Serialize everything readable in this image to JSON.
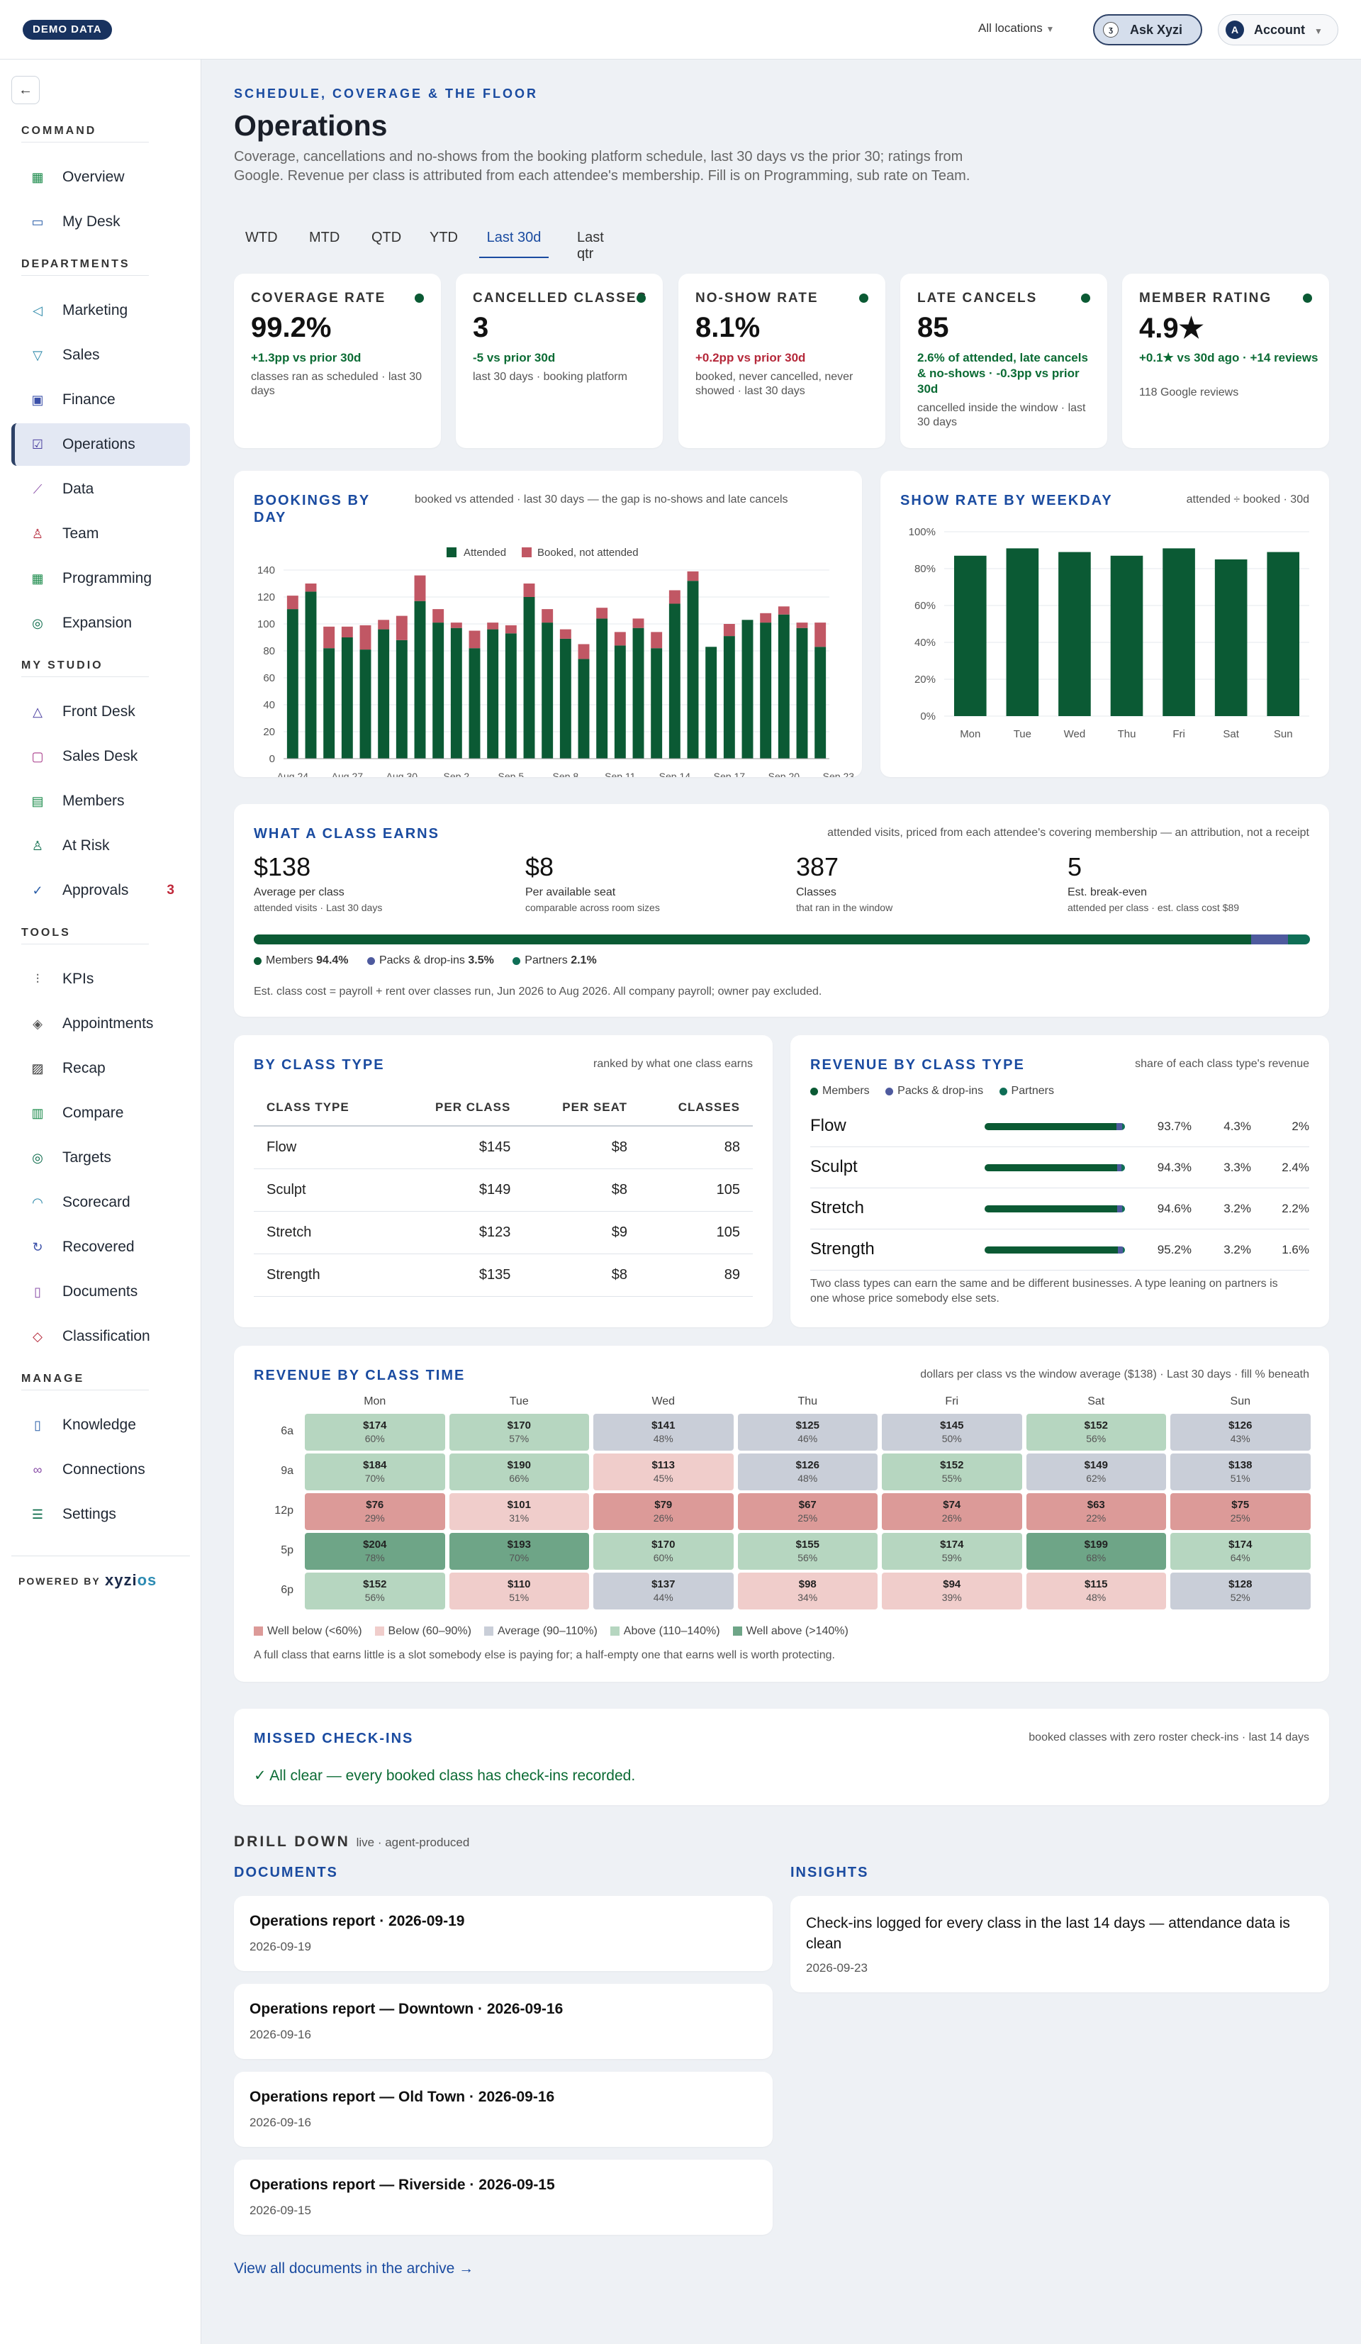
{
  "topbar": {
    "demo_badge": "DEMO DATA",
    "locations": "All locations",
    "ask_label": "Ask Xyzi",
    "ask_icon": "ʒ",
    "account_label": "Account",
    "account_initial": "A"
  },
  "sidebar": {
    "sections": {
      "command": "COMMAND",
      "departments": "DEPARTMENTS",
      "my_studio": "MY STUDIO",
      "tools": "TOOLS",
      "manage": "MANAGE"
    },
    "items": {
      "overview": "Overview",
      "my_desk": "My Desk",
      "marketing": "Marketing",
      "sales": "Sales",
      "finance": "Finance",
      "operations": "Operations",
      "data": "Data",
      "team": "Team",
      "programming": "Programming",
      "expansion": "Expansion",
      "front_desk": "Front Desk",
      "sales_desk": "Sales Desk",
      "members": "Members",
      "at_risk": "At Risk",
      "approvals": "Approvals",
      "approvals_badge": "3",
      "kpis": "KPIs",
      "appointments": "Appointments",
      "recap": "Recap",
      "compare": "Compare",
      "targets": "Targets",
      "scorecard": "Scorecard",
      "recovered": "Recovered",
      "documents": "Documents",
      "classification": "Classification",
      "knowledge": "Knowledge",
      "connections": "Connections",
      "settings": "Settings"
    },
    "powered_by": "POWERED BY",
    "brand_a": "xyzi",
    "brand_b": "os"
  },
  "header": {
    "eyebrow": "SCHEDULE, COVERAGE & THE FLOOR",
    "title": "Operations",
    "description": "Coverage, cancellations and no-shows from the booking platform schedule, last 30 days vs the prior 30; ratings from Google. Revenue per class is attributed from each attendee's membership. Fill is on Programming, sub rate on Team.",
    "tabs": [
      "WTD",
      "MTD",
      "QTD",
      "YTD",
      "Last 30d",
      "Last qtr"
    ],
    "active_tab": "Last 30d"
  },
  "kpis": [
    {
      "label": "COVERAGE RATE",
      "value": "99.2%",
      "delta": "+1.3pp vs prior 30d",
      "tone": "pos",
      "sub": "classes ran as scheduled · last 30 days"
    },
    {
      "label": "CANCELLED CLASSES",
      "value": "3",
      "delta": "-5 vs prior 30d",
      "tone": "pos",
      "sub": "last 30 days · booking platform"
    },
    {
      "label": "NO-SHOW RATE",
      "value": "8.1%",
      "delta": "+0.2pp vs prior 30d",
      "tone": "neg",
      "sub": "booked, never cancelled, never showed · last 30 days"
    },
    {
      "label": "LATE CANCELS",
      "value": "85",
      "delta": "2.6% of attended, late cancels & no-shows · -0.3pp vs prior 30d",
      "tone": "pos",
      "sub": "cancelled inside the window · last 30 days"
    },
    {
      "label": "MEMBER RATING",
      "value": "4.9★",
      "delta": "+0.1★ vs 30d ago · +14 reviews",
      "tone": "pos",
      "sub": "118 Google reviews"
    }
  ],
  "bookings": {
    "title": "BOOKINGS BY DAY",
    "note": "booked vs attended · last 30 days — the gap is no-shows and late cancels",
    "legend_attended": "Attended",
    "legend_booked": "Booked, not attended"
  },
  "showrate": {
    "title": "SHOW RATE BY WEEKDAY",
    "note": "attended ÷ booked · 30d"
  },
  "chart_data": [
    {
      "type": "bar",
      "title": "BOOKINGS BY DAY",
      "stacked": true,
      "x_tick_labels": [
        "Aug 24",
        "Aug 27",
        "Aug 30",
        "Sep 2",
        "Sep 5",
        "Sep 8",
        "Sep 11",
        "Sep 14",
        "Sep 17",
        "Sep 20",
        "Sep 23"
      ],
      "ylim": [
        0,
        140
      ],
      "yticks": [
        0,
        20,
        40,
        60,
        80,
        100,
        120,
        140
      ],
      "series": [
        {
          "name": "Attended",
          "color": "#0b5a34",
          "values": [
            111,
            124,
            82,
            90,
            81,
            96,
            88,
            117,
            101,
            97,
            82,
            96,
            93,
            120,
            101,
            89,
            74,
            104,
            84,
            97,
            82,
            115,
            132,
            83,
            91,
            103,
            101,
            107,
            97,
            83
          ]
        },
        {
          "name": "Booked, not attended",
          "color": "#c15764",
          "values": [
            10,
            6,
            16,
            8,
            18,
            7,
            18,
            19,
            10,
            4,
            13,
            5,
            6,
            10,
            10,
            7,
            11,
            8,
            10,
            7,
            12,
            10,
            7,
            0,
            9,
            0,
            7,
            6,
            4,
            18
          ]
        }
      ],
      "legend": "top",
      "grid": true
    },
    {
      "type": "bar",
      "title": "SHOW RATE BY WEEKDAY",
      "categories": [
        "Mon",
        "Tue",
        "Wed",
        "Thu",
        "Fri",
        "Sat",
        "Sun"
      ],
      "values": [
        87,
        91,
        89,
        87,
        91,
        85,
        89
      ],
      "ylim": [
        0,
        100
      ],
      "yticks": [
        "0%",
        "20%",
        "40%",
        "60%",
        "80%",
        "100%"
      ],
      "color": "#0b5a34"
    }
  ],
  "earns": {
    "title": "WHAT A CLASS EARNS",
    "note": "attended visits, priced from each attendee's covering membership — an attribution, not a receipt",
    "metrics": [
      {
        "value": "$138",
        "label": "Average per class",
        "sub": "attended visits · Last 30 days"
      },
      {
        "value": "$8",
        "label": "Per available seat",
        "sub": "comparable across room sizes"
      },
      {
        "value": "387",
        "label": "Classes",
        "sub": "that ran in the window"
      },
      {
        "value": "5",
        "label": "Est. break-even",
        "sub": "attended per class · est. class cost $89"
      }
    ],
    "mix": [
      {
        "name": "Members",
        "pct": "94.4%",
        "frac": 0.944,
        "color": "#0b5a34"
      },
      {
        "name": "Packs & drop-ins",
        "pct": "3.5%",
        "frac": 0.035,
        "color": "#4e5a9e"
      },
      {
        "name": "Partners",
        "pct": "2.1%",
        "frac": 0.021,
        "color": "#0f6e56"
      }
    ],
    "footnote": "Est. class cost = payroll + rent over classes run, Jun 2026 to Aug 2026. All company payroll; owner pay excluded."
  },
  "by_class": {
    "title": "BY CLASS TYPE",
    "note": "ranked by what one class earns",
    "columns": [
      "CLASS TYPE",
      "PER CLASS",
      "PER SEAT",
      "CLASSES"
    ],
    "rows": [
      [
        "Flow",
        "$145",
        "$8",
        "88"
      ],
      [
        "Sculpt",
        "$149",
        "$8",
        "105"
      ],
      [
        "Stretch",
        "$123",
        "$9",
        "105"
      ],
      [
        "Strength",
        "$135",
        "$8",
        "89"
      ]
    ]
  },
  "rev_class": {
    "title": "REVENUE BY CLASS TYPE",
    "note": "share of each class type's revenue",
    "legend": [
      "Members",
      "Packs & drop-ins",
      "Partners"
    ],
    "rows": [
      {
        "name": "Flow",
        "m": "93.7%",
        "p": "4.3%",
        "t": "2%",
        "mv": 93.7,
        "pv": 4.3,
        "tv": 2
      },
      {
        "name": "Sculpt",
        "m": "94.3%",
        "p": "3.3%",
        "t": "2.4%",
        "mv": 94.3,
        "pv": 3.3,
        "tv": 2.4
      },
      {
        "name": "Stretch",
        "m": "94.6%",
        "p": "3.2%",
        "t": "2.2%",
        "mv": 94.6,
        "pv": 3.2,
        "tv": 2.2
      },
      {
        "name": "Strength",
        "m": "95.2%",
        "p": "3.2%",
        "t": "1.6%",
        "mv": 95.2,
        "pv": 3.2,
        "tv": 1.6
      }
    ],
    "footnote": "Two class types can earn the same and be different businesses. A type leaning on partners is one whose price somebody else sets."
  },
  "rev_time": {
    "title": "REVENUE BY CLASS TIME",
    "note": "dollars per class vs the window average ($138) · Last 30 days · fill % beneath",
    "days": [
      "Mon",
      "Tue",
      "Wed",
      "Thu",
      "Fri",
      "Sat",
      "Sun"
    ],
    "times": [
      "6a",
      "9a",
      "12p",
      "5p",
      "6p"
    ],
    "cells": [
      [
        [
          "$174",
          "60%",
          "above"
        ],
        [
          "$170",
          "57%",
          "above"
        ],
        [
          "$141",
          "48%",
          "avg"
        ],
        [
          "$125",
          "46%",
          "avg"
        ],
        [
          "$145",
          "50%",
          "avg"
        ],
        [
          "$152",
          "56%",
          "above"
        ],
        [
          "$126",
          "43%",
          "avg"
        ]
      ],
      [
        [
          "$184",
          "70%",
          "above"
        ],
        [
          "$190",
          "66%",
          "above"
        ],
        [
          "$113",
          "45%",
          "below"
        ],
        [
          "$126",
          "48%",
          "avg"
        ],
        [
          "$152",
          "55%",
          "above"
        ],
        [
          "$149",
          "62%",
          "avg"
        ],
        [
          "$138",
          "51%",
          "avg"
        ]
      ],
      [
        [
          "$76",
          "29%",
          "wbelow"
        ],
        [
          "$101",
          "31%",
          "below"
        ],
        [
          "$79",
          "26%",
          "wbelow"
        ],
        [
          "$67",
          "25%",
          "wbelow"
        ],
        [
          "$74",
          "26%",
          "wbelow"
        ],
        [
          "$63",
          "22%",
          "wbelow"
        ],
        [
          "$75",
          "25%",
          "wbelow"
        ]
      ],
      [
        [
          "$204",
          "78%",
          "wabove"
        ],
        [
          "$193",
          "70%",
          "wabove"
        ],
        [
          "$170",
          "60%",
          "above"
        ],
        [
          "$155",
          "56%",
          "above"
        ],
        [
          "$174",
          "59%",
          "above"
        ],
        [
          "$199",
          "68%",
          "wabove"
        ],
        [
          "$174",
          "64%",
          "above"
        ]
      ],
      [
        [
          "$152",
          "56%",
          "above"
        ],
        [
          "$110",
          "51%",
          "below"
        ],
        [
          "$137",
          "44%",
          "avg"
        ],
        [
          "$98",
          "34%",
          "below"
        ],
        [
          "$94",
          "39%",
          "below"
        ],
        [
          "$115",
          "48%",
          "below"
        ],
        [
          "$128",
          "52%",
          "avg"
        ]
      ]
    ],
    "legend": [
      "Well below (<60%)",
      "Below (60–90%)",
      "Average (90–110%)",
      "Above (110–140%)",
      "Well above (>140%)"
    ],
    "footnote": "A full class that earns little is a slot somebody else is paying for; a half-empty one that earns well is worth protecting."
  },
  "missed": {
    "title": "MISSED CHECK-INS",
    "note": "booked classes with zero roster check-ins · last 14 days",
    "status": "✓ All clear — every booked class has check-ins recorded."
  },
  "drill": {
    "title": "DRILL DOWN",
    "sub": "live · agent-produced",
    "documents_title": "DOCUMENTS",
    "insights_title": "INSIGHTS",
    "documents": [
      {
        "title": "Operations report · 2026-09-19",
        "date": "2026-09-19"
      },
      {
        "title": "Operations report — Downtown · 2026-09-16",
        "date": "2026-09-16"
      },
      {
        "title": "Operations report — Old Town · 2026-09-16",
        "date": "2026-09-16"
      },
      {
        "title": "Operations report — Riverside · 2026-09-15",
        "date": "2026-09-15"
      }
    ],
    "insights": [
      {
        "title": "Check-ins logged for every class in the last 14 days — attendance data is clean",
        "date": "2026-09-23"
      }
    ],
    "archive_link": "View all documents in the archive →"
  },
  "colors": {
    "primary": "#1a4ba0",
    "attended": "#0b5a34",
    "booked": "#c15764",
    "packs": "#4e5a9e",
    "partners": "#0f6e56",
    "well_below": "#dc9a98",
    "below": "#f0cdcb",
    "average": "#c9ced8",
    "above": "#b6d6c0",
    "well_above": "#6ea587"
  }
}
